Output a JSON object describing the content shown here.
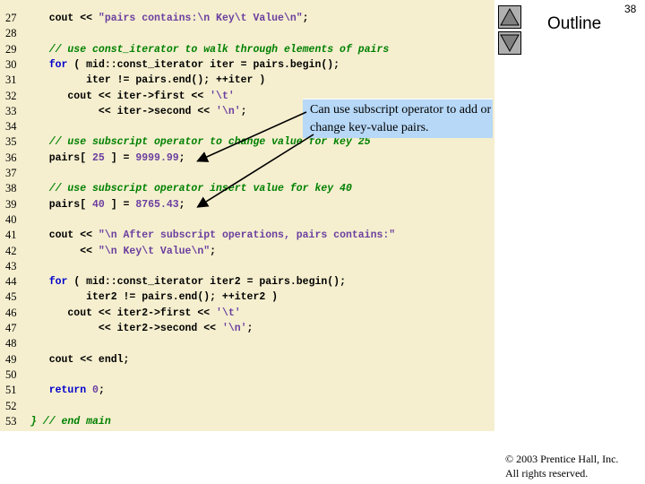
{
  "slide": {
    "page_number": "38",
    "outline_label": "Outline",
    "callout_text": "Can use subscript operator to add or change key-value pairs.",
    "copyright_line1": "© 2003 Prentice Hall, Inc.",
    "copyright_line2": "All rights reserved."
  },
  "nav": {
    "up_icon": "triangle-up",
    "down_icon": "triangle-down"
  },
  "colors": {
    "code_background": "#f5efcf",
    "keyword": "#0000cc",
    "comment": "#008000",
    "literal": "#6b3fa0",
    "callout_background": "#b7d8f7"
  },
  "code_lines": [
    {
      "num": "27",
      "segments": [
        {
          "t": "   cout << "
        },
        {
          "t": "\"pairs contains:\\n Key\\t Value\\n\"",
          "c": "st"
        },
        {
          "t": ";"
        }
      ]
    },
    {
      "num": "28",
      "segments": []
    },
    {
      "num": "29",
      "segments": [
        {
          "t": "   // use const_iterator to walk through elements of pairs",
          "c": "cm"
        }
      ]
    },
    {
      "num": "30",
      "segments": [
        {
          "t": "   "
        },
        {
          "t": "for",
          "c": "kw"
        },
        {
          "t": " ( mid::const_iterator iter = pairs.begin();"
        }
      ]
    },
    {
      "num": "31",
      "segments": [
        {
          "t": "         iter != pairs.end(); ++iter )"
        }
      ]
    },
    {
      "num": "32",
      "segments": [
        {
          "t": "      cout << iter->first << "
        },
        {
          "t": "'\\t'",
          "c": "st"
        }
      ]
    },
    {
      "num": "33",
      "segments": [
        {
          "t": "           << iter->second << "
        },
        {
          "t": "'\\n'",
          "c": "st"
        },
        {
          "t": ";"
        }
      ]
    },
    {
      "num": "34",
      "segments": []
    },
    {
      "num": "35",
      "segments": [
        {
          "t": "   // use subscript operator to change value for key 25",
          "c": "cm"
        }
      ]
    },
    {
      "num": "36",
      "segments": [
        {
          "t": "   pairs[ "
        },
        {
          "t": "25",
          "c": "nm"
        },
        {
          "t": " ] = "
        },
        {
          "t": "9999.99",
          "c": "nm"
        },
        {
          "t": ";"
        }
      ]
    },
    {
      "num": "37",
      "segments": []
    },
    {
      "num": "38",
      "segments": [
        {
          "t": "   // use subscript operator insert value for key 40",
          "c": "cm"
        }
      ]
    },
    {
      "num": "39",
      "segments": [
        {
          "t": "   pairs[ "
        },
        {
          "t": "40",
          "c": "nm"
        },
        {
          "t": " ] = "
        },
        {
          "t": "8765.43",
          "c": "nm"
        },
        {
          "t": ";"
        }
      ]
    },
    {
      "num": "40",
      "segments": []
    },
    {
      "num": "41",
      "segments": [
        {
          "t": "   cout << "
        },
        {
          "t": "\"\\n After subscript operations, pairs contains:\"",
          "c": "st"
        }
      ]
    },
    {
      "num": "42",
      "segments": [
        {
          "t": "        << "
        },
        {
          "t": "\"\\n Key\\t Value\\n\"",
          "c": "st"
        },
        {
          "t": ";"
        }
      ]
    },
    {
      "num": "43",
      "segments": []
    },
    {
      "num": "44",
      "segments": [
        {
          "t": "   "
        },
        {
          "t": "for",
          "c": "kw"
        },
        {
          "t": " ( mid::const_iterator iter2 = pairs.begin();"
        }
      ]
    },
    {
      "num": "45",
      "segments": [
        {
          "t": "         iter2 != pairs.end(); ++iter2 )"
        }
      ]
    },
    {
      "num": "46",
      "segments": [
        {
          "t": "      cout << iter2->first << "
        },
        {
          "t": "'\\t'",
          "c": "st"
        }
      ]
    },
    {
      "num": "47",
      "segments": [
        {
          "t": "           << iter2->second << "
        },
        {
          "t": "'\\n'",
          "c": "st"
        },
        {
          "t": ";"
        }
      ]
    },
    {
      "num": "48",
      "segments": []
    },
    {
      "num": "49",
      "segments": [
        {
          "t": "   cout << endl;"
        }
      ]
    },
    {
      "num": "50",
      "segments": []
    },
    {
      "num": "51",
      "segments": [
        {
          "t": "   "
        },
        {
          "t": "return",
          "c": "kw"
        },
        {
          "t": " "
        },
        {
          "t": "0",
          "c": "nm"
        },
        {
          "t": ";"
        }
      ]
    },
    {
      "num": "52",
      "segments": []
    },
    {
      "num": "53",
      "segments": [
        {
          "t": "} // end main",
          "c": "cm"
        }
      ]
    }
  ]
}
